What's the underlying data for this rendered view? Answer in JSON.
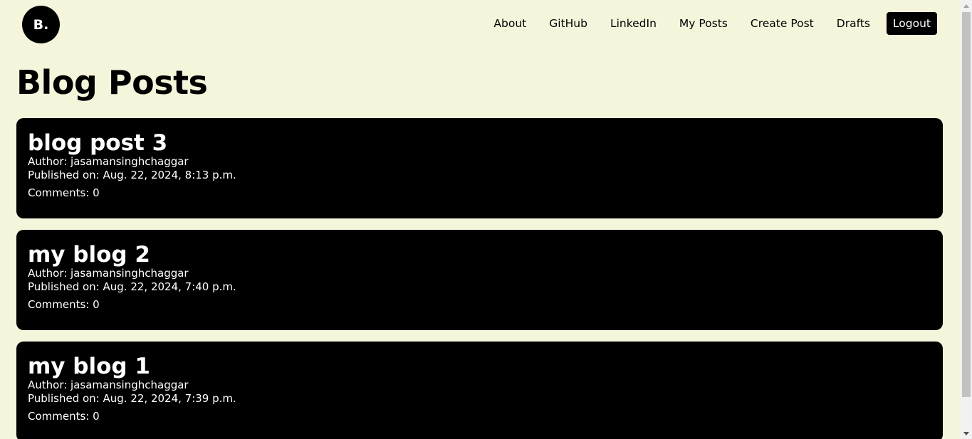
{
  "header": {
    "logo_text": "B.",
    "nav": [
      {
        "label": "About"
      },
      {
        "label": "GitHub"
      },
      {
        "label": "LinkedIn"
      },
      {
        "label": "My Posts"
      },
      {
        "label": "Create Post"
      },
      {
        "label": "Drafts"
      }
    ],
    "logout_label": "Logout"
  },
  "main": {
    "title": "Blog Posts",
    "posts": [
      {
        "title": "blog post 3",
        "author": "Author: jasamansinghchaggar",
        "published": "Published on: Aug. 22, 2024, 8:13 p.m.",
        "comments": "Comments: 0"
      },
      {
        "title": "my blog 2",
        "author": "Author: jasamansinghchaggar",
        "published": "Published on: Aug. 22, 2024, 7:40 p.m.",
        "comments": "Comments: 0"
      },
      {
        "title": "my blog 1",
        "author": "Author: jasamansinghchaggar",
        "published": "Published on: Aug. 22, 2024, 7:39 p.m.",
        "comments": "Comments: 0"
      }
    ]
  },
  "colors": {
    "background": "#f5f5dc",
    "card": "#000000",
    "card_text": "#ffffff"
  },
  "icons": {
    "scroll_up": "chevron-up-icon",
    "scroll_down": "chevron-down-icon"
  }
}
